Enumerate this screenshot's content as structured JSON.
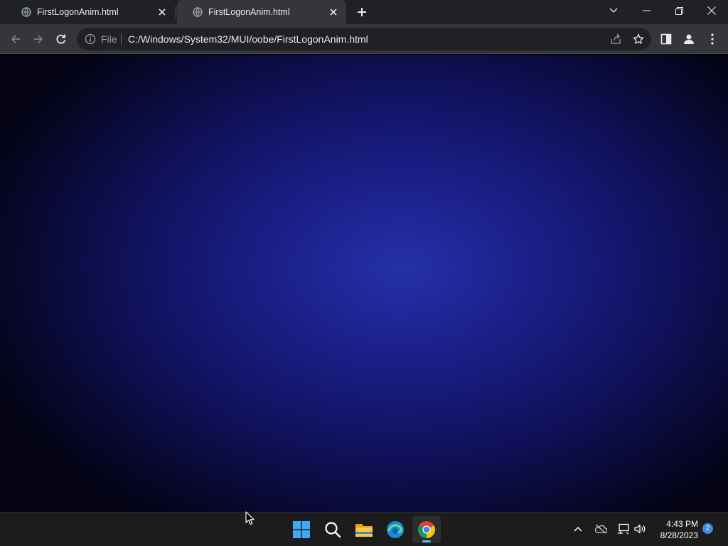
{
  "browser": {
    "tabs": [
      {
        "title": "FirstLogonAnim.html",
        "active": false
      },
      {
        "title": "FirstLogonAnim.html",
        "active": true
      }
    ],
    "address_bar": {
      "scheme_label": "File",
      "url": "C:/Windows/System32/MUI/oobe/FirstLogonAnim.html"
    }
  },
  "page": {
    "background_center_color": "#2530a8",
    "background_edge_color": "#030315"
  },
  "taskbar": {
    "apps": [
      "start-icon",
      "search-icon",
      "file-explorer-icon",
      "edge-icon",
      "chrome-icon"
    ],
    "active_app": "chrome-icon",
    "clock": {
      "time": "4:43 PM",
      "date": "8/28/2023"
    },
    "notification_count": "2"
  }
}
